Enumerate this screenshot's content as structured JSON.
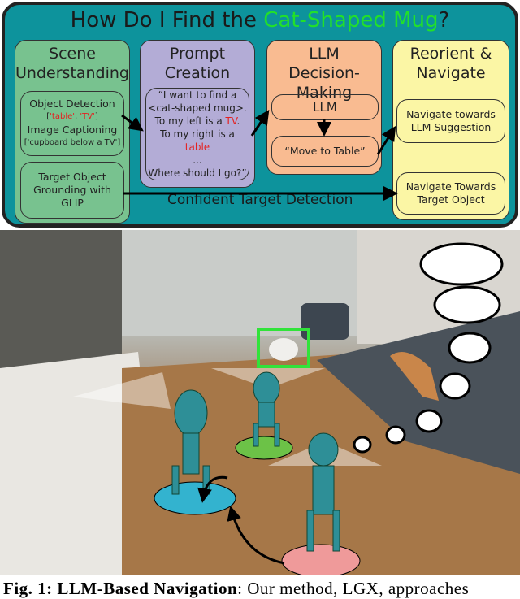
{
  "title": {
    "prefix": "How Do I Find the ",
    "highlight": "Cat-Shaped Mug",
    "suffix": "?"
  },
  "columns": {
    "scene": {
      "heading": "Scene Understanding",
      "od_title": "Object Detection",
      "od_list_open": "[",
      "od_a": "'table'",
      "od_sep": ", ",
      "od_b": "'TV'",
      "od_list_close": "]",
      "ic_title": "Image Captioning",
      "ic_value": "['cupboard below a TV']",
      "grounding": "Target Object Grounding with GLIP"
    },
    "prompt": {
      "heading": "Prompt Creation",
      "l1": "“I want to find a",
      "l2": "<cat-shaped mug>.",
      "l3a": "To my left is a ",
      "l3b": "TV",
      "l3c": ".",
      "l4a": "To my right is a ",
      "l4b": "table",
      "l5": "...",
      "l6": "Where should I go?”"
    },
    "llm": {
      "heading": "LLM Decision-Making",
      "llm": "LLM",
      "output": "“Move to Table”"
    },
    "nav": {
      "heading": "Reorient & Navigate",
      "suggestion": "Navigate towards LLM Suggestion",
      "target": "Navigate Towards Target Object"
    }
  },
  "edge_label": "Confident Target Detection",
  "colors": {
    "panel": "#0d939c",
    "scene": "#78c28f",
    "prompt": "#b3acd6",
    "llm": "#f9bb91",
    "nav": "#fbf6a5",
    "highlight": "#22e02a",
    "detected": "#e52020"
  },
  "caption": {
    "label": "Fig. 1:",
    "bold": "LLM-Based Navigation",
    "text": ": Our method, LGX, approaches"
  }
}
